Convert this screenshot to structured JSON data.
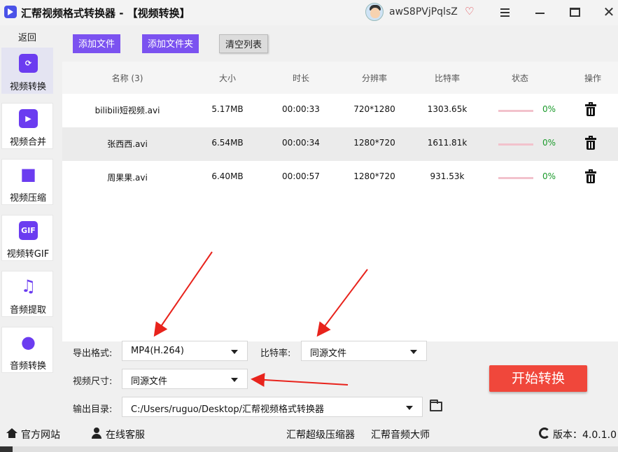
{
  "title": "汇帮视频格式转换器  - 【视频转换】",
  "user": {
    "name": "awS8PVjPqlsZ"
  },
  "sidebar": {
    "back_label": "返回",
    "items": [
      {
        "label": "视频转换",
        "icon": "video-convert-icon",
        "active": true
      },
      {
        "label": "视频合并",
        "icon": "video-merge-icon"
      },
      {
        "label": "视频压缩",
        "icon": "video-camera-icon"
      },
      {
        "label": "视频转GIF",
        "icon": "gif-icon"
      },
      {
        "label": "音频提取",
        "icon": "music-note-icon"
      },
      {
        "label": "音频转换",
        "icon": "microphone-icon"
      }
    ]
  },
  "toolbar": {
    "add_file": "添加文件",
    "add_folder": "添加文件夹",
    "clear_list": "清空列表"
  },
  "table": {
    "headers": [
      "名称 (3)",
      "大小",
      "时长",
      "分辨率",
      "比特率",
      "状态",
      "操作"
    ],
    "rows": [
      {
        "name": "bilibili短视频.avi",
        "size": "5.17MB",
        "duration": "00:00:33",
        "resolution": "720*1280",
        "bitrate": "1303.65k",
        "progress": "0%"
      },
      {
        "name": "张西西.avi",
        "size": "6.54MB",
        "duration": "00:00:34",
        "resolution": "1280*720",
        "bitrate": "1611.81k",
        "progress": "0%"
      },
      {
        "name": "周果果.avi",
        "size": "6.40MB",
        "duration": "00:00:57",
        "resolution": "1280*720",
        "bitrate": "931.53k",
        "progress": "0%"
      }
    ]
  },
  "settings": {
    "format_label": "导出格式:",
    "format_value": "MP4(H.264)",
    "bitrate_label": "比特率:",
    "bitrate_value": "同源文件",
    "size_label": "视频尺寸:",
    "size_value": "同源文件",
    "output_label": "输出目录:",
    "output_value": "C:/Users/ruguo/Desktop/汇帮视频格式转换器",
    "start_button": "开始转换"
  },
  "footer": {
    "website": "官方网站",
    "support": "在线客服",
    "compressor": "汇帮超级压缩器",
    "audio_master": "汇帮音频大师",
    "version": "版本：4.0.1.0"
  },
  "colors": {
    "accent": "#7b52f0",
    "start": "#f0473b",
    "progress_text": "#1a9a2a",
    "progress_track": "#f2c2cc",
    "annotation_arrow": "#e8231c"
  }
}
